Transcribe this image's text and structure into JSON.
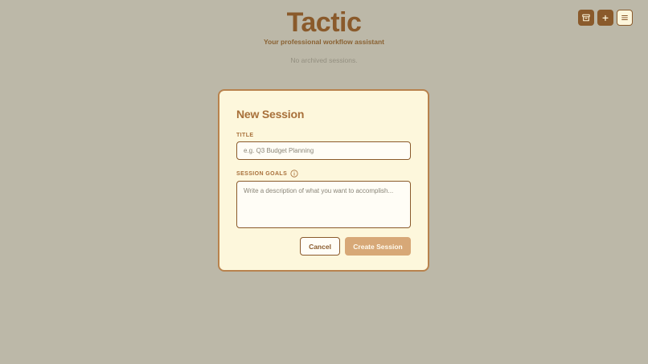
{
  "app": {
    "title": "Tactic",
    "subtitle": "Your professional workflow assistant"
  },
  "sessions": {
    "empty_message": "No archived sessions."
  },
  "toolbar": {
    "archive_icon": "archive-icon",
    "add_icon": "plus-icon",
    "menu_icon": "hamburger-menu-icon"
  },
  "modal": {
    "title": "New Session",
    "title_label": "TITLE",
    "title_placeholder": "e.g. Q3 Budget Planning",
    "title_value": "",
    "goals_label": "SESSION GOALS",
    "goals_placeholder": "Write a description of what you want to accomplish...",
    "goals_value": "",
    "info_icon": "info-icon",
    "cancel_label": "Cancel",
    "create_label": "Create Session"
  },
  "colors": {
    "background": "#bcb8a8",
    "brand": "#8a5a2b",
    "accent": "#a8703a",
    "modal_bg": "#fdf7dc",
    "primary_disabled": "#d7a877"
  }
}
